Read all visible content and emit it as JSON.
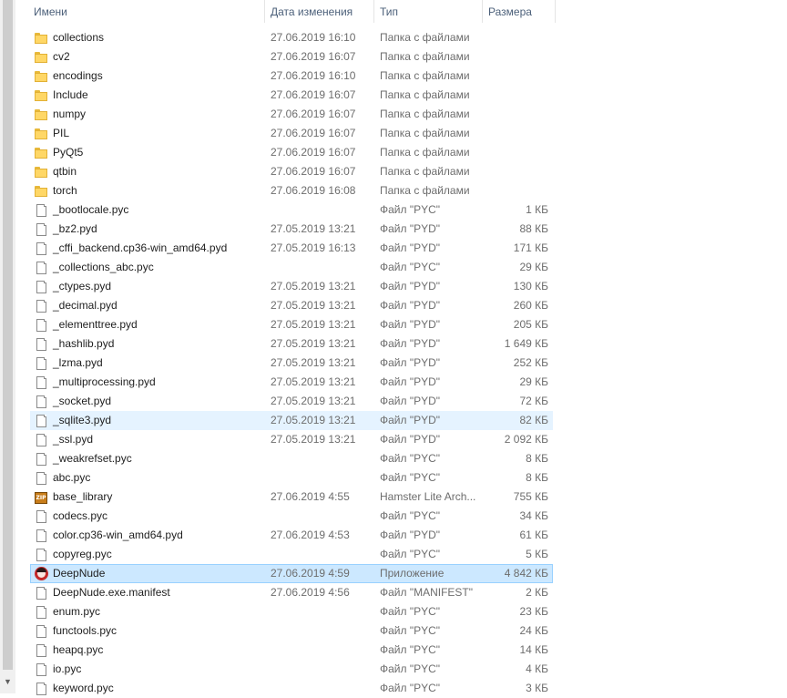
{
  "header": {
    "col_name": "Имени",
    "col_date": "Дата изменения",
    "col_type": "Тип",
    "col_size": "Размера",
    "sort_indicator": "^"
  },
  "scrollbar": {
    "down_arrow": "▼"
  },
  "files": [
    {
      "name": "collections",
      "date": "27.06.2019 16:10",
      "type": "Папка с файлами",
      "size": "",
      "icon": "folder-icon"
    },
    {
      "name": "cv2",
      "date": "27.06.2019 16:07",
      "type": "Папка с файлами",
      "size": "",
      "icon": "folder-icon"
    },
    {
      "name": "encodings",
      "date": "27.06.2019 16:10",
      "type": "Папка с файлами",
      "size": "",
      "icon": "folder-icon"
    },
    {
      "name": "Include",
      "date": "27.06.2019 16:07",
      "type": "Папка с файлами",
      "size": "",
      "icon": "folder-icon"
    },
    {
      "name": "numpy",
      "date": "27.06.2019 16:07",
      "type": "Папка с файлами",
      "size": "",
      "icon": "folder-icon"
    },
    {
      "name": "PIL",
      "date": "27.06.2019 16:07",
      "type": "Папка с файлами",
      "size": "",
      "icon": "folder-icon"
    },
    {
      "name": "PyQt5",
      "date": "27.06.2019 16:07",
      "type": "Папка с файлами",
      "size": "",
      "icon": "folder-icon"
    },
    {
      "name": "qtbin",
      "date": "27.06.2019 16:07",
      "type": "Папка с файлами",
      "size": "",
      "icon": "folder-icon"
    },
    {
      "name": "torch",
      "date": "27.06.2019 16:08",
      "type": "Папка с файлами",
      "size": "",
      "icon": "folder-icon"
    },
    {
      "name": "_bootlocale.pyc",
      "date": "",
      "type": "Файл \"PYC\"",
      "size": "1 КБ",
      "icon": "file-icon"
    },
    {
      "name": "_bz2.pyd",
      "date": "27.05.2019 13:21",
      "type": "Файл \"PYD\"",
      "size": "88 КБ",
      "icon": "file-icon"
    },
    {
      "name": "_cffi_backend.cp36-win_amd64.pyd",
      "date": "27.05.2019 16:13",
      "type": "Файл \"PYD\"",
      "size": "171 КБ",
      "icon": "file-icon"
    },
    {
      "name": "_collections_abc.pyc",
      "date": "",
      "type": "Файл \"PYC\"",
      "size": "29 КБ",
      "icon": "file-icon"
    },
    {
      "name": "_ctypes.pyd",
      "date": "27.05.2019 13:21",
      "type": "Файл \"PYD\"",
      "size": "130 КБ",
      "icon": "file-icon"
    },
    {
      "name": "_decimal.pyd",
      "date": "27.05.2019 13:21",
      "type": "Файл \"PYD\"",
      "size": "260 КБ",
      "icon": "file-icon"
    },
    {
      "name": "_elementtree.pyd",
      "date": "27.05.2019 13:21",
      "type": "Файл \"PYD\"",
      "size": "205 КБ",
      "icon": "file-icon"
    },
    {
      "name": "_hashlib.pyd",
      "date": "27.05.2019 13:21",
      "type": "Файл \"PYD\"",
      "size": "1 649 КБ",
      "icon": "file-icon"
    },
    {
      "name": "_lzma.pyd",
      "date": "27.05.2019 13:21",
      "type": "Файл \"PYD\"",
      "size": "252 КБ",
      "icon": "file-icon"
    },
    {
      "name": "_multiprocessing.pyd",
      "date": "27.05.2019 13:21",
      "type": "Файл \"PYD\"",
      "size": "29 КБ",
      "icon": "file-icon"
    },
    {
      "name": "_socket.pyd",
      "date": "27.05.2019 13:21",
      "type": "Файл \"PYD\"",
      "size": "72 КБ",
      "icon": "file-icon"
    },
    {
      "name": "_sqlite3.pyd",
      "date": "27.05.2019 13:21",
      "type": "Файл \"PYD\"",
      "size": "82 КБ",
      "icon": "file-icon",
      "state": "hover"
    },
    {
      "name": "_ssl.pyd",
      "date": "27.05.2019 13:21",
      "type": "Файл \"PYD\"",
      "size": "2 092 КБ",
      "icon": "file-icon"
    },
    {
      "name": "_weakrefset.pyc",
      "date": "",
      "type": "Файл \"PYC\"",
      "size": "8 КБ",
      "icon": "file-icon"
    },
    {
      "name": "abc.pyc",
      "date": "",
      "type": "Файл \"PYC\"",
      "size": "8 КБ",
      "icon": "file-icon"
    },
    {
      "name": "base_library",
      "date": "27.06.2019 4:55",
      "type": "Hamster Lite Arch...",
      "size": "755 КБ",
      "icon": "zip-archive-icon"
    },
    {
      "name": "codecs.pyc",
      "date": "",
      "type": "Файл \"PYC\"",
      "size": "34 КБ",
      "icon": "file-icon"
    },
    {
      "name": "color.cp36-win_amd64.pyd",
      "date": "27.06.2019 4:53",
      "type": "Файл \"PYD\"",
      "size": "61 КБ",
      "icon": "file-icon"
    },
    {
      "name": "copyreg.pyc",
      "date": "",
      "type": "Файл \"PYC\"",
      "size": "5 КБ",
      "icon": "file-icon"
    },
    {
      "name": "DeepNude",
      "date": "27.06.2019 4:59",
      "type": "Приложение",
      "size": "4 842 КБ",
      "icon": "app-icon",
      "state": "selected"
    },
    {
      "name": "DeepNude.exe.manifest",
      "date": "27.06.2019 4:56",
      "type": "Файл \"MANIFEST\"",
      "size": "2 КБ",
      "icon": "file-icon"
    },
    {
      "name": "enum.pyc",
      "date": "",
      "type": "Файл \"PYC\"",
      "size": "23 КБ",
      "icon": "file-icon"
    },
    {
      "name": "functools.pyc",
      "date": "",
      "type": "Файл \"PYC\"",
      "size": "24 КБ",
      "icon": "file-icon"
    },
    {
      "name": "heapq.pyc",
      "date": "",
      "type": "Файл \"PYC\"",
      "size": "14 КБ",
      "icon": "file-icon"
    },
    {
      "name": "io.pyc",
      "date": "",
      "type": "Файл \"PYC\"",
      "size": "4 КБ",
      "icon": "file-icon"
    },
    {
      "name": "keyword.pyc",
      "date": "",
      "type": "Файл \"PYC\"",
      "size": "3 КБ",
      "icon": "file-icon"
    }
  ]
}
